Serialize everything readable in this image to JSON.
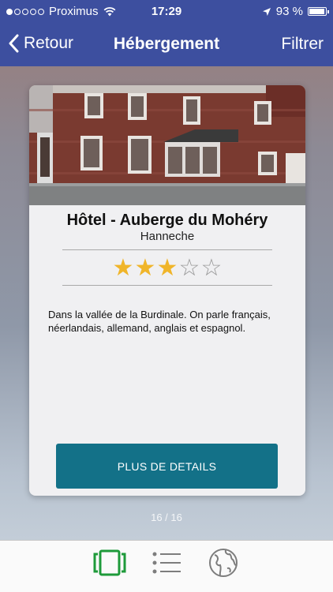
{
  "status_bar": {
    "carrier": "Proximus",
    "time": "17:29",
    "battery": "93 %",
    "battery_level": 0.93,
    "signal_bars": 1,
    "signal_total": 5
  },
  "nav": {
    "back_label": "Retour",
    "title": "Hébergement",
    "filter_label": "Filtrer",
    "bar_color": "#3d4f9f"
  },
  "hotel": {
    "name": "Hôtel - Auberge du Mohéry",
    "city": "Hanneche",
    "rating": 3,
    "rating_max": 5,
    "description": "Dans la vallée de la Burdinale. On parle français, néerlandais, allemand, anglais et espagnol.",
    "details_button": "PLUS DE DETAILS"
  },
  "pager": {
    "text": "16 / 16"
  },
  "tabs": [
    {
      "name": "cards",
      "icon": "cards-icon",
      "active": true
    },
    {
      "name": "list",
      "icon": "list-icon",
      "active": false
    },
    {
      "name": "map",
      "icon": "globe-icon",
      "active": false
    }
  ],
  "colors": {
    "accent": "#137188",
    "star": "#f0b52a",
    "active_tab": "#1e9a3a",
    "inactive_tab": "#7d7d7d"
  }
}
